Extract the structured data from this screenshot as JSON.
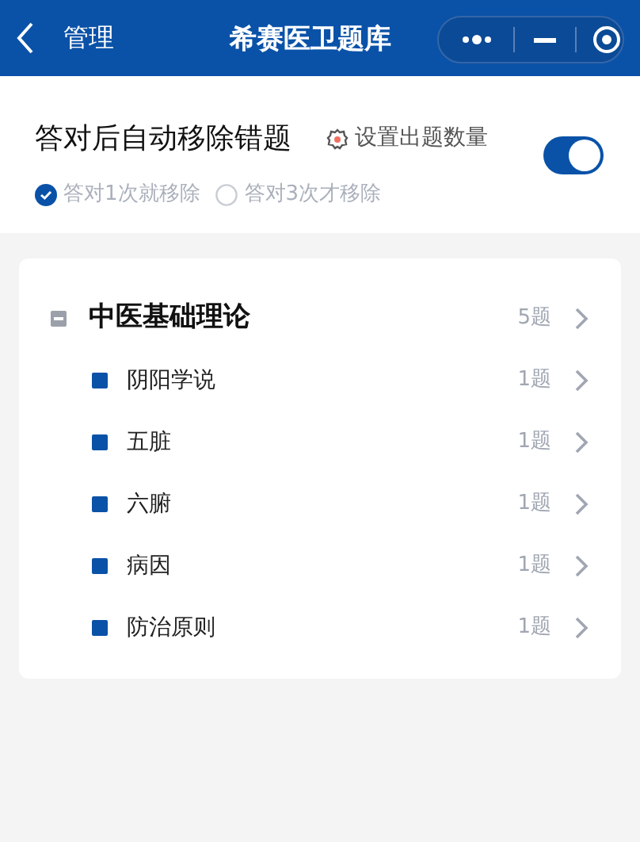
{
  "nav": {
    "back_label": "管理",
    "title": "希赛医卫题库"
  },
  "settings": {
    "label": "答对后自动移除错题",
    "config_link": "设置出题数量",
    "auto_remove": {
      "on": true
    },
    "options": [
      {
        "label": "答对1次就移除",
        "selected": true
      },
      {
        "label": "答对3次才移除",
        "selected": false
      }
    ]
  },
  "tree": [
    {
      "label": "中医基础理论",
      "count": "5题",
      "expanded": true,
      "children": [
        {
          "label": "阴阳学说",
          "count": "1题"
        },
        {
          "label": "五脏",
          "count": "1题"
        },
        {
          "label": "六腑",
          "count": "1题"
        },
        {
          "label": "病因",
          "count": "1题"
        },
        {
          "label": "防治原则",
          "count": "1题"
        }
      ]
    }
  ]
}
